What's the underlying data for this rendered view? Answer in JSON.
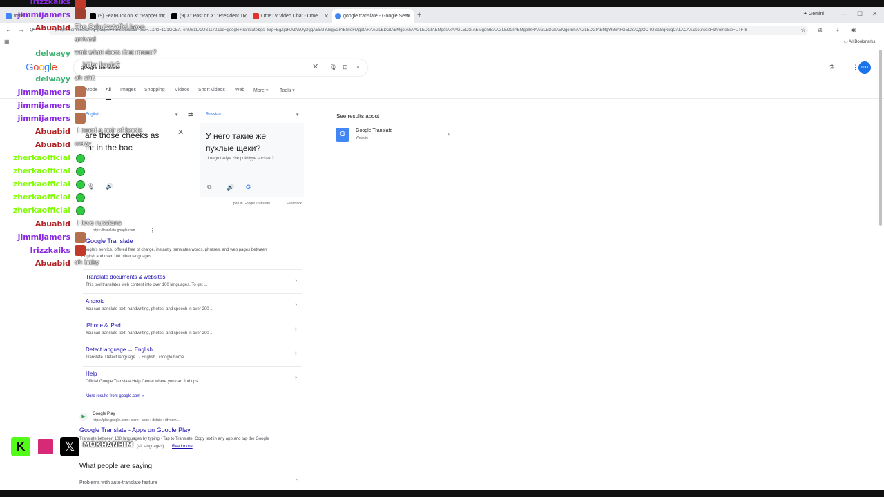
{
  "browser": {
    "tabs": [
      {
        "label": "trans",
        "color": "#5f6368"
      },
      {
        "label": "(9) FearBuck on X: \"Rapper fro",
        "color": "#000000"
      },
      {
        "label": "(9) X\" Post on X: \"President Tr",
        "color": "#000000"
      },
      {
        "label": "OmeTV Video Chat - Ome",
        "color": "#e2322c"
      },
      {
        "label": "google translate - Google Sear",
        "color": "#4285f4"
      }
    ],
    "new_tab": "+",
    "gemini": "Gemini",
    "url": "google.com/search?q=google+translate&sca_esv=...&rlz=1C1GCEA_enUS1172US1172&oq=google+translate&gs_lcrp=EgZjaHJvbWUyDggAEEUYJxg5GIAEGIoFMgoIARAAGLEDGIAEMgoIAhAAGLEDGIAEMgoIAxAAGLEDGIAEMgoIBBAAGLEDGIAEMgoIBRAAGLEDGIAEMgoIBhAAGLEDGIAEMgYIBxAFGEDSAQgOOTUSajBqN6gCALACAA&sourceid=chrome&ie=UTF-8",
    "all_bookmarks": "All Bookmarks",
    "profile": "mo"
  },
  "search": {
    "logo": "Google",
    "query": "google translate",
    "tabs": [
      "Mode",
      "All",
      "Images",
      "Shopping",
      "Videos",
      "Short videos",
      "Web",
      "More",
      "Tools"
    ]
  },
  "translate": {
    "source_lang": "English",
    "target_lang": "Russian",
    "source_text_1": "are those cheeks as",
    "source_text_2": "fat in the bac",
    "target_text_1": "У него такие же",
    "target_text_2": "пухлые щеки?",
    "transliteration": "U nego takiye zhe pukhlyye shcheki?",
    "open_link": "Open in Google Translate",
    "feedback": "Feedback"
  },
  "knowledge": {
    "heading": "See results about",
    "title": "Google Translate",
    "subtitle": "Website"
  },
  "result": {
    "url": "https://translate.google.com",
    "title": "Google Translate",
    "snippet_1": "Google's service, offered free of charge, instantly translates words, phrases, and web pages between",
    "snippet_2": "English and over 100 other languages.",
    "sitelinks": [
      {
        "title": "Translate documents & websites",
        "desc": "This tool translates web content into over 100 languages. To get ..."
      },
      {
        "title": "Android",
        "desc": "You can translate text, handwriting, photos, and speech in over 200 ..."
      },
      {
        "title": "iPhone & iPad",
        "desc": "You can translate text, handwriting, photos, and speech in over 200 ..."
      },
      {
        "title": "Detect language → English",
        "desc": "Translate. Detect language → English · Google home ..."
      },
      {
        "title": "Help",
        "desc": "Official Google Translate Help Center where you can find tips ..."
      }
    ],
    "more": "More results from google.com »"
  },
  "result2": {
    "site": "Google Play",
    "url": "https://play.google.com › store › apps › details › id=com...",
    "title": "Google Translate - Apps on Google Play",
    "snippet": "Translate between 108 languages by typing · Tap to Translate: Copy text in any app and tap the Google",
    "snippet_end": "(all languages).",
    "read_more": "Read more"
  },
  "people": {
    "heading": "What people are saying",
    "item": "Problems with auto-translate feature"
  },
  "chat": [
    {
      "name": "Irizzkaiks",
      "color": "#8a2be2",
      "msg": ""
    },
    {
      "name": "jimmijamers",
      "color": "#8a2be2",
      "msg": ""
    },
    {
      "name": "Abuabid",
      "color": "#b22222",
      "msg": "The Schutzstaffel have"
    },
    {
      "name": "",
      "color": "#fff",
      "msg": "arrived"
    },
    {
      "name": "delwayy",
      "color": "#3cb371",
      "msg": "wait what does that mean?"
    },
    {
      "name": "",
      "color": "#fff",
      "msg": "hitler basic?"
    },
    {
      "name": "delwayy",
      "color": "#3cb371",
      "msg": "oh shit"
    },
    {
      "name": "jimmijamers",
      "color": "#8a2be2",
      "msg": ""
    },
    {
      "name": "jimmijamers",
      "color": "#8a2be2",
      "msg": ""
    },
    {
      "name": "jimmijamers",
      "color": "#8a2be2",
      "msg": ""
    },
    {
      "name": "Abuabid",
      "color": "#b22222",
      "msg": "I need a pair of boots"
    },
    {
      "name": "Abuabid",
      "color": "#b22222",
      "msg": "crazy"
    },
    {
      "name": "zherkaofficial",
      "color": "#7fff00",
      "msg": ""
    },
    {
      "name": "zherkaofficial",
      "color": "#7fff00",
      "msg": ""
    },
    {
      "name": "zherkaofficial",
      "color": "#7fff00",
      "msg": ""
    },
    {
      "name": "zherkaofficial",
      "color": "#7fff00",
      "msg": ""
    },
    {
      "name": "zherkaofficial",
      "color": "#7fff00",
      "msg": ""
    },
    {
      "name": "Abuabid",
      "color": "#b22222",
      "msg": "I love russians"
    },
    {
      "name": "jimmijamers",
      "color": "#8a2be2",
      "msg": ""
    },
    {
      "name": "Irizzkaiks",
      "color": "#8a2be2",
      "msg": ""
    },
    {
      "name": "Abuabid",
      "color": "#b22222",
      "msg": "oh baby"
    }
  ],
  "streamer_handle": "MOKHANHIM"
}
